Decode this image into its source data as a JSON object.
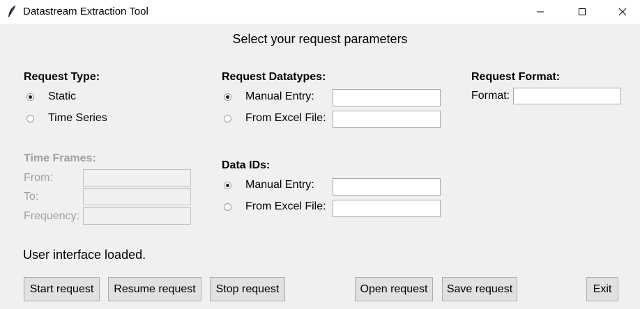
{
  "window": {
    "title": "Datastream Extraction Tool",
    "icon": "feather-icon"
  },
  "header": "Select your request parameters",
  "request_type": {
    "title": "Request Type:",
    "options": [
      {
        "label": "Static",
        "selected": true
      },
      {
        "label": "Time Series",
        "selected": false
      }
    ]
  },
  "time_frames": {
    "title": "Time Frames:",
    "from_label": "From:",
    "to_label": "To:",
    "frequency_label": "Frequency:",
    "from_value": "",
    "to_value": "",
    "frequency_value": ""
  },
  "request_datatypes": {
    "title": "Request Datatypes:",
    "manual_label": "Manual Entry:",
    "excel_label": "From Excel File:",
    "manual_value": "",
    "excel_value": "",
    "selected": "manual"
  },
  "data_ids": {
    "title": "Data IDs:",
    "manual_label": "Manual Entry:",
    "excel_label": "From Excel File:",
    "manual_value": "",
    "excel_value": "",
    "selected": "manual"
  },
  "request_format": {
    "title": "Request Format:",
    "format_label": "Format:",
    "format_value": ""
  },
  "status": "User interface loaded.",
  "buttons": {
    "start": "Start request",
    "resume": "Resume request",
    "stop": "Stop request",
    "open": "Open request",
    "save": "Save request",
    "exit": "Exit"
  }
}
